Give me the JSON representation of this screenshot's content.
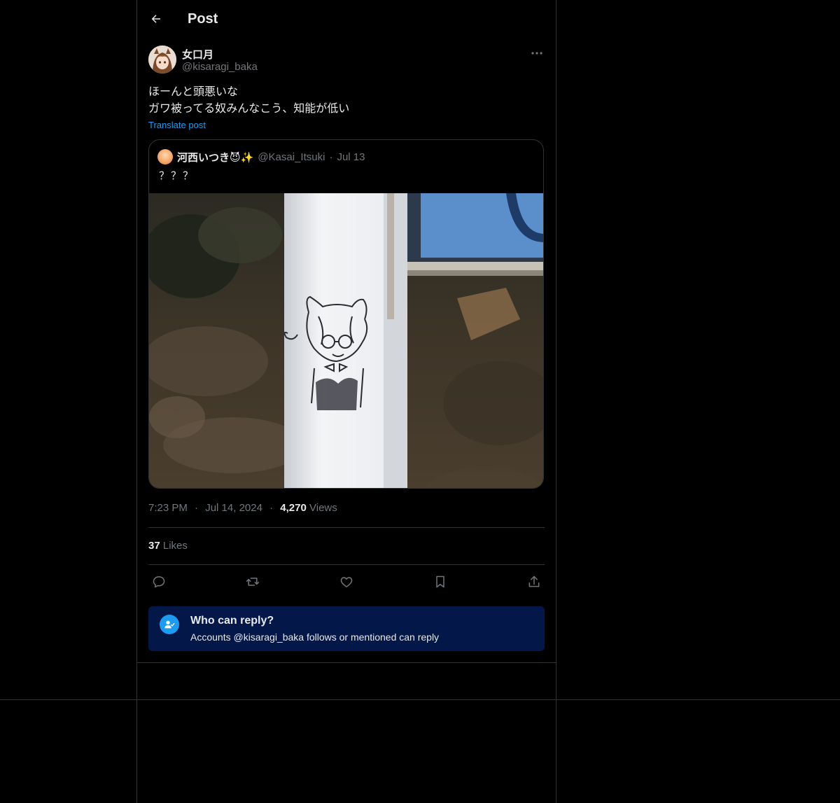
{
  "header": {
    "title": "Post",
    "back_icon": "arrow-left-icon"
  },
  "author": {
    "name": "女口月",
    "handle": "@kisaragi_baka"
  },
  "post": {
    "lines": [
      "ほーんと頭悪いな",
      "ガワ被ってる奴みんなこう、知能が低い"
    ],
    "translate_label": "Translate post"
  },
  "quote": {
    "name": "河西いつき😈✨",
    "handle": "@Kasai_Itsuki",
    "separator": "·",
    "date": "Jul 13",
    "text": "？？？"
  },
  "meta": {
    "time": "7:23 PM",
    "date": "Jul 14, 2024",
    "separator": "·",
    "views_count": "4,270",
    "views_label": "Views"
  },
  "likes": {
    "count": "37",
    "label": "Likes"
  },
  "actions": [
    "reply-icon",
    "repost-icon",
    "like-icon",
    "bookmark-icon",
    "share-icon"
  ],
  "reply_restriction": {
    "title": "Who can reply?",
    "subtitle": "Accounts @kisaragi_baka follows or mentioned can reply"
  },
  "colors": {
    "background": "#000000",
    "text": "#e7e9ea",
    "muted": "#71767b",
    "accent": "#1d9bf0",
    "border": "#2f3336",
    "reply_box": "#031849"
  }
}
